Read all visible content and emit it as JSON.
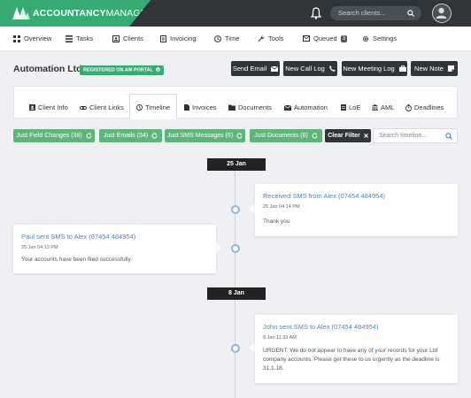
{
  "topbar": {
    "brand_bold": "ACCOUNTANCY",
    "brand_rest": "MANAGER",
    "search_placeholder": "Search clients...",
    "icons": [
      "logo-icon",
      "bell-icon",
      "search-icon",
      "user-avatar"
    ]
  },
  "nav": {
    "items": [
      {
        "label": "Overview",
        "icon": "grid-icon"
      },
      {
        "label": "Tasks",
        "icon": "list-icon"
      },
      {
        "label": "Clients",
        "icon": "contact-card-icon"
      },
      {
        "label": "Invoicing",
        "icon": "invoice-icon"
      },
      {
        "label": "Time",
        "icon": "clock-icon"
      },
      {
        "label": "Tools",
        "icon": "wrench-icon"
      },
      {
        "label": "Queued",
        "icon": "mail-icon",
        "badge": "3"
      },
      {
        "label": "Settings",
        "icon": "gear-icon"
      }
    ]
  },
  "client": {
    "name": "Automation Ltd",
    "portal_badge": "REGISTERED ON AM PORTAL"
  },
  "actions": {
    "new_email": "Send Email",
    "new_call_log": "New Call Log",
    "new_meeting_log": "New Meeting Log",
    "new_note": "New Note"
  },
  "tabs": [
    {
      "label": "Client Info",
      "icon": "id-card-icon"
    },
    {
      "label": "Client Links",
      "icon": "link-icon"
    },
    {
      "label": "Timeline",
      "icon": "clock-icon",
      "active": true
    },
    {
      "label": "Invoices",
      "icon": "document-icon"
    },
    {
      "label": "Documents",
      "icon": "folder-icon"
    },
    {
      "label": "Automation",
      "icon": "mail-icon"
    },
    {
      "label": "LoE",
      "icon": "file-icon"
    },
    {
      "label": "AML",
      "icon": "bank-icon"
    },
    {
      "label": "Deadlines",
      "icon": "stopwatch-icon"
    }
  ],
  "filters": {
    "field_changes": "Just Field Changes (38)",
    "emails": "Just Emails (34)",
    "sms": "Just SMS Messages (6)",
    "documents": "Just Documents (6)",
    "clear": "Clear Filter",
    "search_placeholder": "Search timeline..."
  },
  "colors": {
    "brand_green": "#36ab73",
    "dark": "#2f3539",
    "filter_green": "#5fb47b",
    "link_blue": "#4a86c8",
    "dot_blue": "#8fb4e3"
  },
  "timeline": {
    "groups": [
      {
        "date": "25 Jan",
        "entries": [
          {
            "side": "right",
            "title": "Received SMS from Alex (07454 484954)",
            "time": "25 Jan 04:14 PM",
            "body": "Thank you"
          },
          {
            "side": "left",
            "title": "Paul sent SMS to Alex (07454 484954)",
            "time": "25 Jan 04:13 PM",
            "body": "Your accounts have been filed successfully."
          }
        ]
      },
      {
        "date": "8 Jan",
        "entries": [
          {
            "side": "right",
            "title": "John sent SMS to Alex (07454 484954)",
            "time": "8 Jan 11:33 AM",
            "body": "URGENT: We do not appear to have any of your records for your Ltd company accounts. Please get these to us urgently as the deadline is 31.1.18."
          }
        ]
      }
    ]
  }
}
